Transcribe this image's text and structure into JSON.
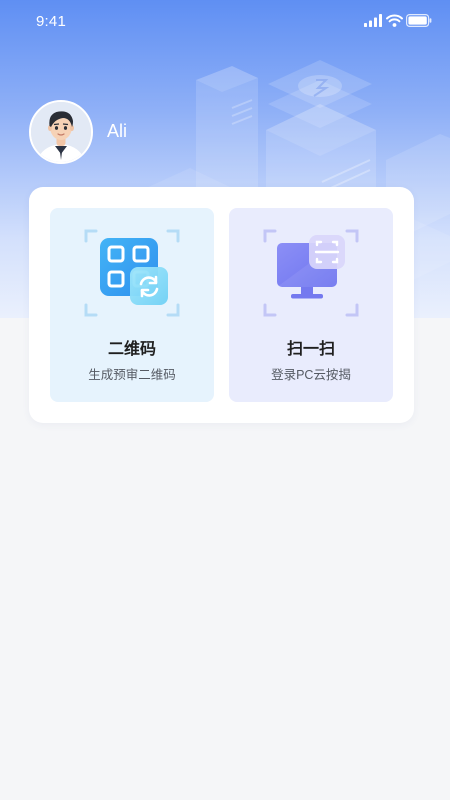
{
  "status_bar": {
    "time": "9:41"
  },
  "user": {
    "name": "Ali"
  },
  "actions": [
    {
      "title": "二维码",
      "subtitle": "生成预审二维码",
      "icon": "qr-code-icon"
    },
    {
      "title": "扫一扫",
      "subtitle": "登录PC云按揭",
      "icon": "scan-monitor-icon"
    }
  ],
  "colors": {
    "hero_top": "#5f8ff3",
    "page_background": "#f5f6f8",
    "qr_tile": "#e6f3fd",
    "scan_tile": "#e9ecfd",
    "qr_accent": "#3aa8f2",
    "scan_accent": "#7f85f3"
  }
}
